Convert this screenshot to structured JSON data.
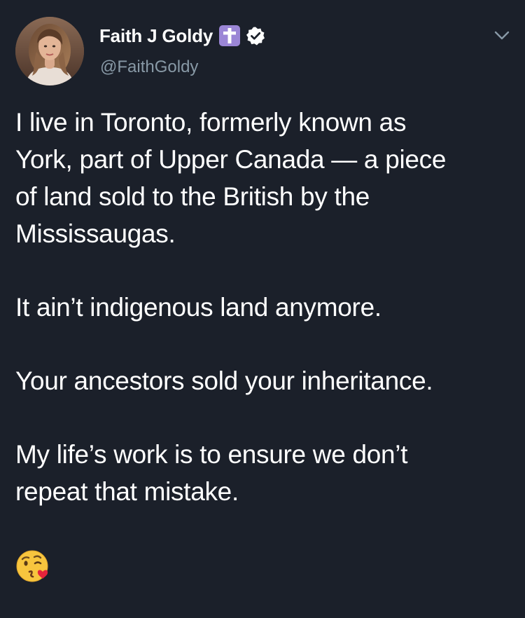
{
  "tweet": {
    "author": {
      "display_name": "Faith J Goldy",
      "handle": "@FaithGoldy",
      "avatar_icon": "profile-photo",
      "name_badges": [
        "latin-cross-icon",
        "verified-check-icon"
      ]
    },
    "menu_icon": "chevron-down-icon",
    "paragraphs": [
      "I live in Toronto, formerly known as\nYork, part of Upper Canada — a piece\nof land sold to the British by the\nMississaugas.",
      "It ain’t indigenous land anymore.",
      "Your ancestors sold your inheritance.",
      "My life’s work is to ensure we don’t\nrepeat that mistake."
    ],
    "emoji": "face-blowing-a-kiss-emoji"
  },
  "colors": {
    "background": "#1b202a",
    "text": "#ffffff",
    "secondary_text": "#8899a6",
    "cross_badge": "#9b86d6",
    "verified_badge": "#ffffff"
  }
}
